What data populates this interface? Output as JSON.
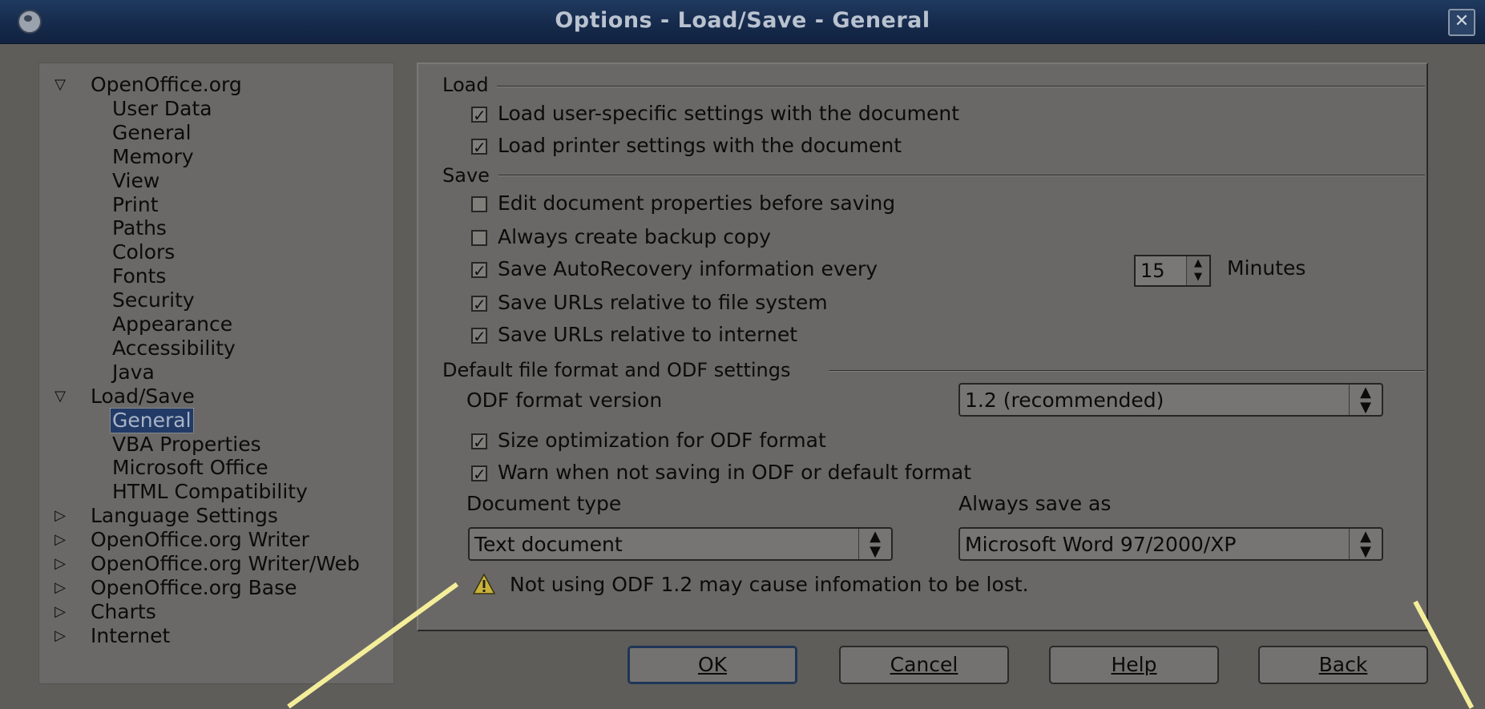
{
  "window": {
    "title": "Options - Load/Save - General",
    "close_glyph": "✕"
  },
  "tree": {
    "nodes": [
      {
        "label": "OpenOffice.org",
        "level": 0,
        "expanded": true
      },
      {
        "label": "User Data",
        "level": 1
      },
      {
        "label": "General",
        "level": 1
      },
      {
        "label": "Memory",
        "level": 1
      },
      {
        "label": "View",
        "level": 1
      },
      {
        "label": "Print",
        "level": 1
      },
      {
        "label": "Paths",
        "level": 1
      },
      {
        "label": "Colors",
        "level": 1
      },
      {
        "label": "Fonts",
        "level": 1
      },
      {
        "label": "Security",
        "level": 1
      },
      {
        "label": "Appearance",
        "level": 1
      },
      {
        "label": "Accessibility",
        "level": 1
      },
      {
        "label": "Java",
        "level": 1
      },
      {
        "label": "Load/Save",
        "level": 0,
        "expanded": true
      },
      {
        "label": "General",
        "level": 1,
        "selected": true
      },
      {
        "label": "VBA Properties",
        "level": 1
      },
      {
        "label": "Microsoft Office",
        "level": 1
      },
      {
        "label": "HTML Compatibility",
        "level": 1
      },
      {
        "label": "Language Settings",
        "level": 0,
        "expanded": false
      },
      {
        "label": "OpenOffice.org Writer",
        "level": 0,
        "expanded": false
      },
      {
        "label": "OpenOffice.org Writer/Web",
        "level": 0,
        "expanded": false
      },
      {
        "label": "OpenOffice.org Base",
        "level": 0,
        "expanded": false
      },
      {
        "label": "Charts",
        "level": 0,
        "expanded": false
      },
      {
        "label": "Internet",
        "level": 0,
        "expanded": false
      }
    ]
  },
  "load": {
    "heading": "Load",
    "user_settings": {
      "label": "Load user-specific settings with the document",
      "checked": true
    },
    "printer_settings": {
      "label": "Load printer settings with the document",
      "checked": true
    }
  },
  "save": {
    "heading": "Save",
    "edit_props": {
      "label": "Edit document properties before saving",
      "checked": false
    },
    "backup": {
      "label": "Always create backup copy",
      "checked": false
    },
    "autorecovery": {
      "label": "Save AutoRecovery information every",
      "checked": true
    },
    "autorecovery_minutes": "15",
    "minutes_label": "Minutes",
    "urls_fs": {
      "label": "Save URLs relative to file system",
      "checked": true
    },
    "urls_inet": {
      "label": "Save URLs relative to internet",
      "checked": true
    }
  },
  "format": {
    "heading": "Default file format and ODF settings",
    "odf_version_label": "ODF format version",
    "odf_version_value": "1.2 (recommended)",
    "size_opt": {
      "label": "Size optimization for ODF format",
      "checked": true
    },
    "warn_not_odf": {
      "label": "Warn when not saving in ODF or default format",
      "checked": true
    },
    "doc_type_label": "Document type",
    "doc_type_value": "Text document",
    "save_as_label": "Always save as",
    "save_as_value": "Microsoft Word 97/2000/XP",
    "warning": "Not using ODF 1.2 may cause infomation to be lost."
  },
  "buttons": {
    "ok": "OK",
    "cancel": "Cancel",
    "help": "Help",
    "back": "Back"
  },
  "icons": [
    "app-icon",
    "close-icon",
    "expander-triangle-icon",
    "checkbox-check-icon",
    "spin-arrows-icon",
    "combo-arrows-icon",
    "warning-icon"
  ],
  "colors": {
    "selection": "#223a66",
    "annotation_line": "#f4ee9a",
    "titlebar": "#15294a"
  }
}
